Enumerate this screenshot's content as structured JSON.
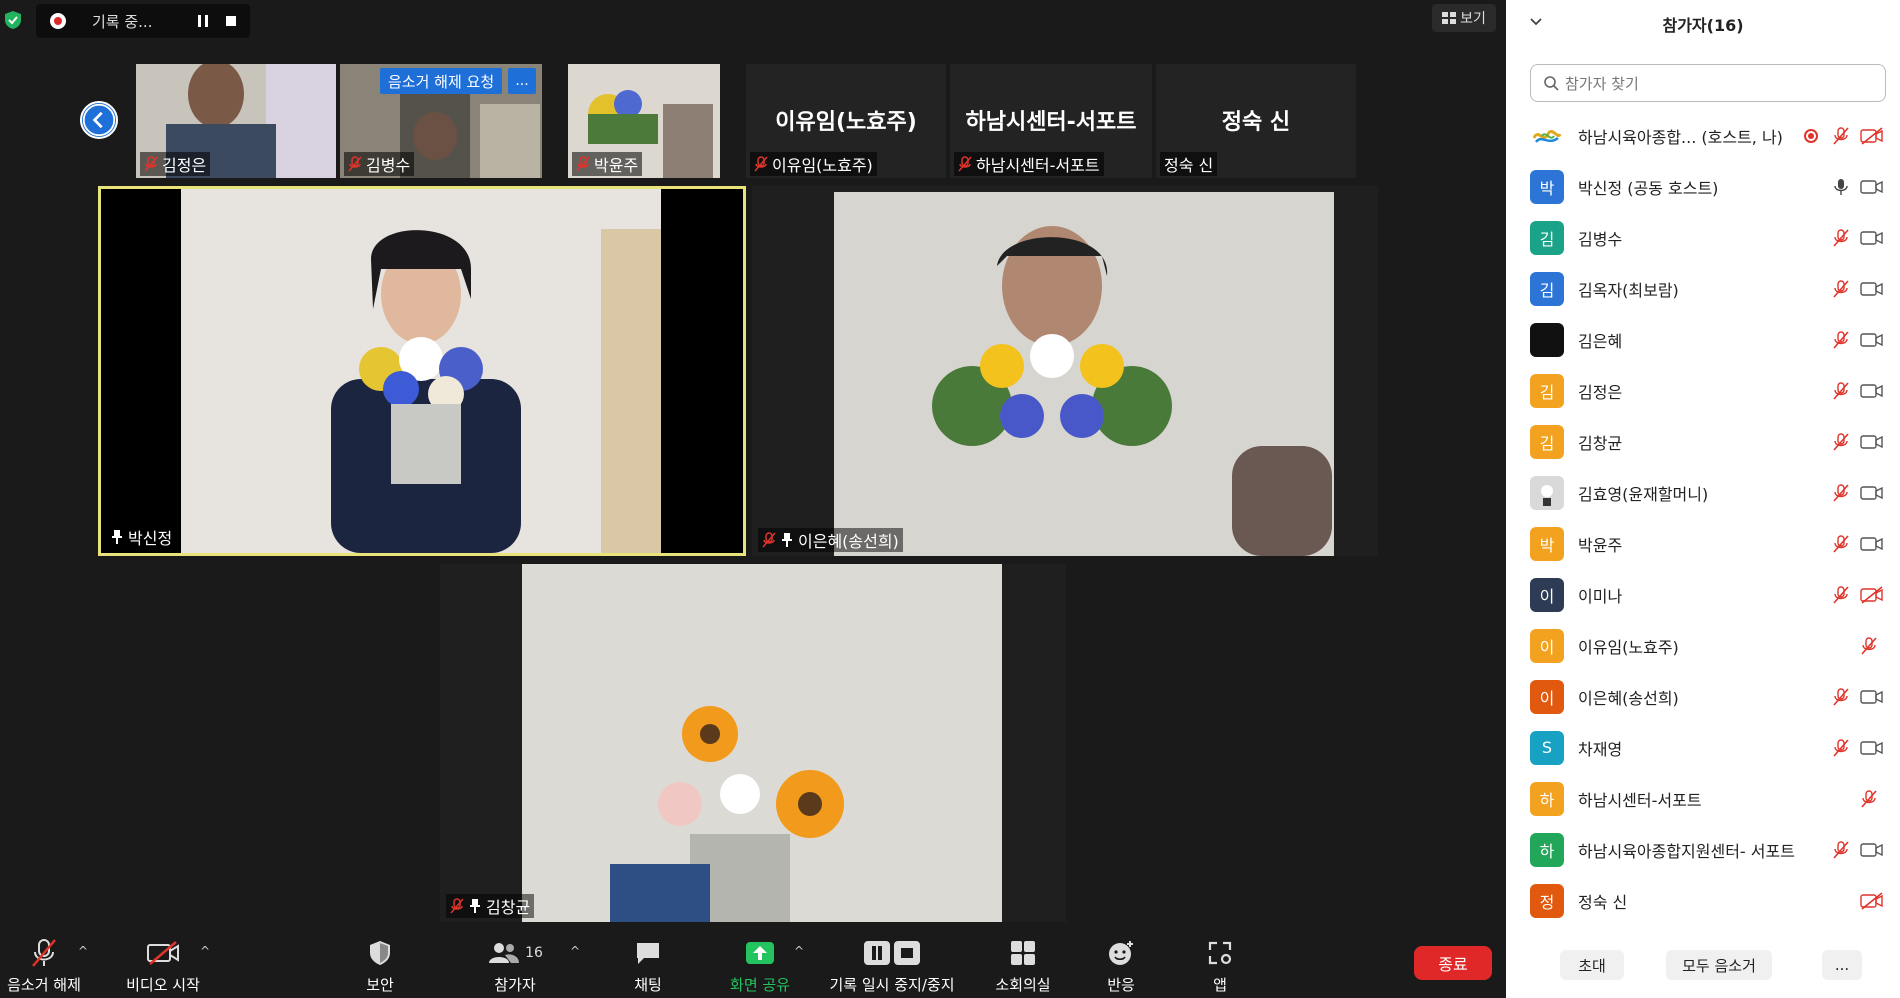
{
  "recording": {
    "label": "기록 중..."
  },
  "view_button": {
    "label": "보기"
  },
  "thumbnails": [
    {
      "name": "김정은",
      "type": "video",
      "muted": true
    },
    {
      "name": "김병수",
      "type": "video",
      "muted": true
    },
    {
      "name": "박윤주",
      "type": "video",
      "muted": true
    },
    {
      "name": "이유임(노효주)",
      "bigname": "이유임(노효주)",
      "type": "name",
      "muted": true
    },
    {
      "name": "하남시센터-서포트",
      "bigname": "하남시센터-서포트",
      "type": "name",
      "muted": true
    },
    {
      "name": "정숙 신",
      "bigname": "정숙 신",
      "type": "name",
      "muted": false
    }
  ],
  "unmute_request": {
    "label": "음소거 해제 요청",
    "more": "..."
  },
  "tiles": {
    "active": {
      "name": "박신정"
    },
    "right": {
      "name": "이은혜(송선희)"
    },
    "bottom": {
      "name": "김창균"
    }
  },
  "toolbar": {
    "unmute": "음소거 해제",
    "start_video": "비디오 시작",
    "security": "보안",
    "participants": "참가자",
    "participant_count": "16",
    "chat": "채팅",
    "share": "화면 공유",
    "record": "기록 일시 중지/중지",
    "breakout": "소회의실",
    "reactions": "반응",
    "apps": "앱",
    "end": "종료"
  },
  "panel": {
    "title": "참가자(16)",
    "search_placeholder": "참가자 찾기",
    "participants": [
      {
        "avatar": "",
        "name": "하남시육아종합...   (호스트, 나)",
        "color": "#ffffff",
        "mic": "off",
        "video": "off",
        "recording": true,
        "logo": true
      },
      {
        "avatar": "박",
        "name": "박신정 (공동 호스트)",
        "color": "#2c74d6",
        "mic": "on",
        "video": "on"
      },
      {
        "avatar": "김",
        "name": "김병수",
        "color": "#1aa389",
        "mic": "off",
        "video": "on"
      },
      {
        "avatar": "김",
        "name": "김옥자(최보람)",
        "color": "#2c74d6",
        "mic": "off",
        "video": "on"
      },
      {
        "avatar": "",
        "name": "김은혜",
        "color": "#111111",
        "mic": "off",
        "video": "on"
      },
      {
        "avatar": "김",
        "name": "김정은",
        "color": "#f2a21f",
        "mic": "off",
        "video": "on"
      },
      {
        "avatar": "김",
        "name": "김창균",
        "color": "#f2a21f",
        "mic": "off",
        "video": "on"
      },
      {
        "avatar": "",
        "name": "김효영(윤재할머니)",
        "color": "#d9d9d9",
        "mic": "off",
        "video": "on"
      },
      {
        "avatar": "박",
        "name": "박윤주",
        "color": "#f2a21f",
        "mic": "off",
        "video": "on"
      },
      {
        "avatar": "이",
        "name": "이미나",
        "color": "#2e3b55",
        "mic": "off",
        "video": "off"
      },
      {
        "avatar": "이",
        "name": "이유임(노효주)",
        "color": "#f2a21f",
        "mic": "off",
        "video": "none"
      },
      {
        "avatar": "이",
        "name": "이은혜(송선희)",
        "color": "#e0590f",
        "mic": "off",
        "video": "on"
      },
      {
        "avatar": "S",
        "name": "차재영",
        "color": "#17a2c4",
        "mic": "off",
        "video": "on"
      },
      {
        "avatar": "하",
        "name": "하남시센터-서포트",
        "color": "#f2a21f",
        "mic": "off",
        "video": "none"
      },
      {
        "avatar": "하",
        "name": "하남시육아종합지원센터- 서포트",
        "color": "#22a65a",
        "mic": "off",
        "video": "on"
      },
      {
        "avatar": "정",
        "name": "정숙 신",
        "color": "#e0590f",
        "mic": "none",
        "video": "off"
      }
    ],
    "invite": "초대",
    "mute_all": "모두 음소거",
    "more": "..."
  }
}
